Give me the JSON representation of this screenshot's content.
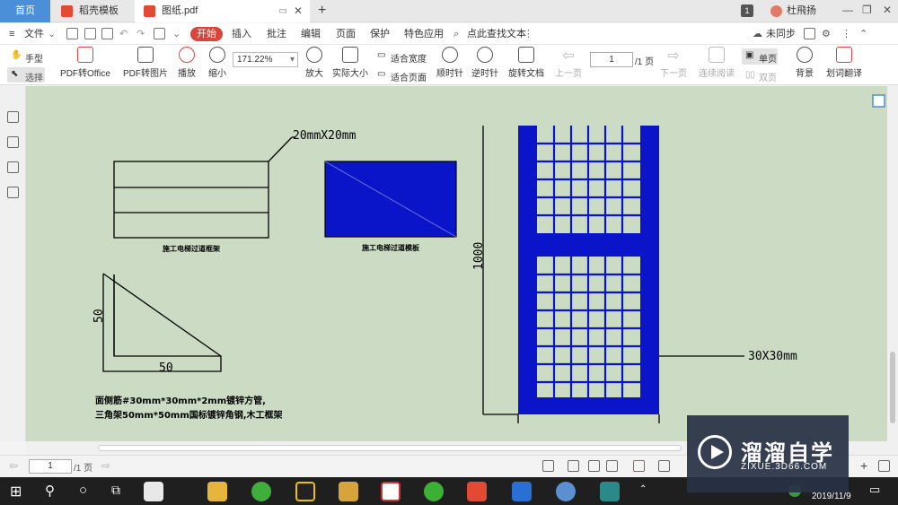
{
  "tabs": {
    "home": "首页",
    "t1": "稻壳模板",
    "t2": "图纸.pdf",
    "new": "+"
  },
  "titlebar": {
    "badge": "1",
    "user": "杜飛扬"
  },
  "menu": {
    "file": "文件",
    "start": "开始",
    "insert": "插入",
    "annotate": "批注",
    "edit": "编辑",
    "page": "页面",
    "protect": "保护",
    "special": "特色应用",
    "search": "点此查找文本",
    "sync": "未同步"
  },
  "toolbar": {
    "hand": "手型",
    "select": "选择",
    "pdf_office": "PDF转Office",
    "pdf_image": "PDF转图片",
    "play": "播放",
    "zoom_out": "缩小",
    "zoom_value": "171.22%",
    "fit_width": "适合宽度",
    "fit_page": "适合页面",
    "zoom_in": "放大",
    "actual": "实际大小",
    "cw": "顺时针",
    "ccw": "逆时针",
    "rotate": "旋转文档",
    "prev": "上一页",
    "page_value": "1",
    "page_total": "/1 页",
    "next": "下一页",
    "continuous": "连续阅读",
    "single": "单页",
    "double": "双页",
    "background": "背景",
    "translate": "划词翻译"
  },
  "drawing": {
    "label_size": "20mmX20mm",
    "label_rack": "施工电梯过道框架",
    "label_panel": "施工电梯过道模板",
    "dim_50a": "50",
    "dim_50b": "50",
    "dim_1000": "1000",
    "dim_30": "30X30mm",
    "note1": "面侧筋#30mm*30mm*2mm镀锌方管,",
    "note2": "三角架50mm*50mm国标镀锌角钢,木工框架",
    "panel_color": "#0a14c8",
    "line_color": "#000000"
  },
  "status": {
    "page_value": "1",
    "page_total": "/1 页"
  },
  "taskbar": {
    "clock": "2019/11/9"
  },
  "watermark": {
    "title": "溜溜自学",
    "sub": "ZIXUE.3D66.COM"
  }
}
